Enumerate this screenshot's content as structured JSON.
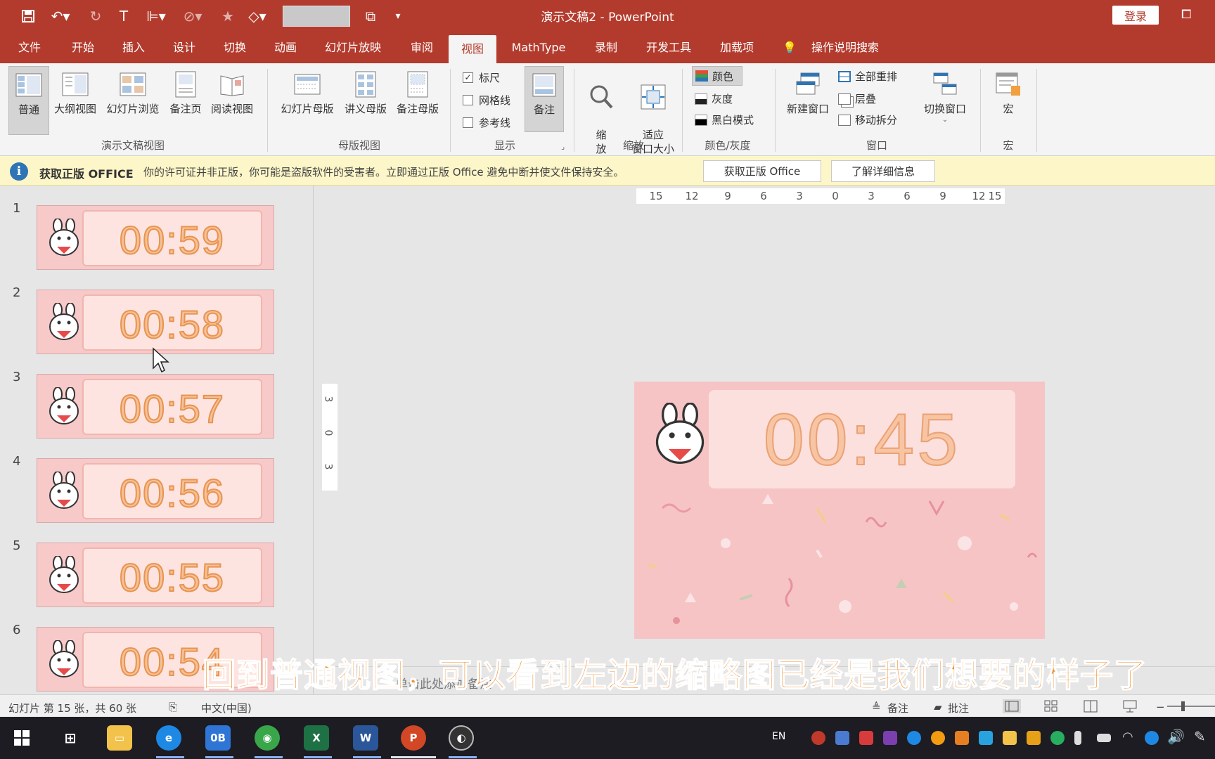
{
  "window": {
    "title": "演示文稿2 - PowerPoint",
    "login_label": "登录"
  },
  "tabs": [
    "文件",
    "开始",
    "插入",
    "设计",
    "切换",
    "动画",
    "幻灯片放映",
    "审阅",
    "视图",
    "MathType",
    "录制",
    "开发工具",
    "加载项"
  ],
  "active_tab": "视图",
  "tell_me": "操作说明搜索",
  "ribbon": {
    "presentation_views": {
      "label": "演示文稿视图",
      "buttons": [
        "普通",
        "大纲视图",
        "幻灯片浏览",
        "备注页",
        "阅读视图"
      ]
    },
    "master_views": {
      "label": "母版视图",
      "buttons": [
        "幻灯片母版",
        "讲义母版",
        "备注母版"
      ]
    },
    "show": {
      "label": "显示",
      "items": [
        {
          "label": "标尺",
          "checked": true
        },
        {
          "label": "网格线",
          "checked": false
        },
        {
          "label": "参考线",
          "checked": false
        }
      ],
      "notes_button": "备注"
    },
    "zoom": {
      "label": "缩放",
      "zoom_button": "缩\n放",
      "fit_button": "适应\n窗口大小"
    },
    "color": {
      "label": "颜色/灰度",
      "items": [
        "颜色",
        "灰度",
        "黑白模式"
      ]
    },
    "window": {
      "label": "窗口",
      "new_window": "新建窗口",
      "arrange_all": "全部重排",
      "cascade": "层叠",
      "move_split": "移动拆分",
      "switch_windows": "切换窗口"
    },
    "macros": {
      "label": "宏",
      "button": "宏"
    }
  },
  "infobar": {
    "title": "获取正版 OFFICE",
    "text": "你的许可证并非正版，你可能是盗版软件的受害者。立即通过正版 Office 避免中断并使文件保持安全。",
    "btn_get": "获取正版 Office",
    "btn_learn": "了解详细信息"
  },
  "thumbnails": [
    {
      "num": "1",
      "time": "00:59"
    },
    {
      "num": "2",
      "time": "00:58"
    },
    {
      "num": "3",
      "time": "00:57"
    },
    {
      "num": "4",
      "time": "00:56"
    },
    {
      "num": "5",
      "time": "00:55"
    },
    {
      "num": "6",
      "time": "00:54"
    }
  ],
  "ruler": {
    "h_ticks": [
      "15",
      "12",
      "9",
      "6",
      "3",
      "0",
      "3",
      "6",
      "9",
      "12",
      "15"
    ],
    "v_ticks": [
      "3",
      "0",
      "3"
    ]
  },
  "slide": {
    "time": "00:45"
  },
  "notes_hint": "单击此处添加备注",
  "subtitle": "回到普通视图，可以看到左边的缩略图已经是我们想要的样子了",
  "statusbar": {
    "slide_info": "幻灯片 第 15 张，共 60 张",
    "language": "中文(中国)",
    "notes": "备注",
    "comments": "批注"
  },
  "taskbar": {
    "lang": "EN"
  },
  "colors": {
    "brand": "#b33b2d",
    "slide_bg": "#f7c4c6",
    "timer_stroke": "#eba070",
    "subtitle": "#f1902e"
  }
}
